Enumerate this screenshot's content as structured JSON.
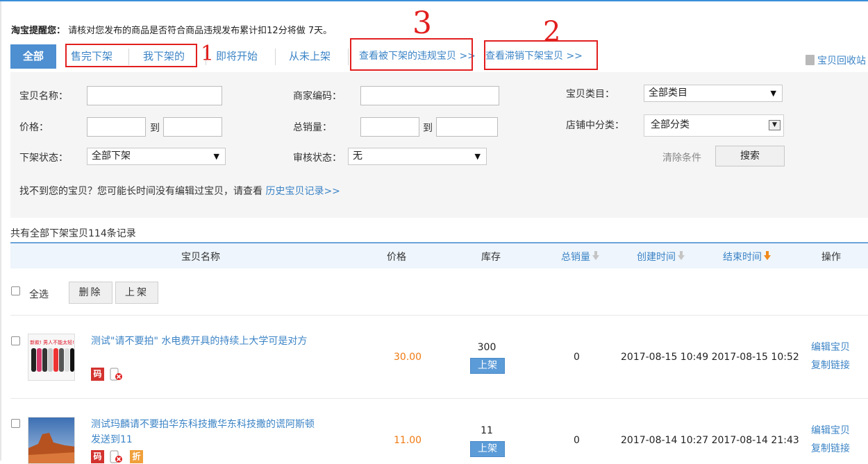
{
  "notice": {
    "prefix": "淘宝提醒您：",
    "text": "请核对您发布的商品是否符合商品违规发布累计扣12分将做 7天。"
  },
  "tabs": {
    "all": "全部",
    "sold_out": "售完下架",
    "mine": "我下架的",
    "coming": "即将开始",
    "never": "从未上架",
    "violations": "查看被下架的违规宝贝 >>",
    "slow": "查看滞销下架宝贝 >>",
    "recycle": "宝贝回收站"
  },
  "annotations": {
    "mark1": "1",
    "mark2": "2",
    "mark3": "3"
  },
  "filters": {
    "name_label": "宝贝名称：",
    "code_label": "商家编码：",
    "category_label": "宝贝类目：",
    "category_value": "全部类目",
    "price_label": "价格：",
    "to": "到",
    "sales_label": "总销量：",
    "shop_cat_label": "店铺中分类：",
    "shop_cat_value": "全部分类",
    "status_label": "下架状态：",
    "status_value": "全部下架",
    "review_label": "审核状态：",
    "review_value": "无",
    "clear": "清除条件",
    "search": "搜索",
    "hint_text": "找不到您的宝贝？您可能长时间没有编辑过宝贝，请查看 ",
    "hint_link": "历史宝贝记录>>"
  },
  "summary": "共有全部下架宝贝114条记录",
  "table": {
    "headers": {
      "name": "宝贝名称",
      "price": "价格",
      "stock": "库存",
      "sales": "总销量",
      "created": "创建时间",
      "ended": "结束时间",
      "ops": "操作"
    },
    "select_all": "全选",
    "delete": "删除",
    "list": "上架",
    "rows": [
      {
        "title": "测试\"请不要拍\" 水电费开具的持续上大学可是对方",
        "price": "30.00",
        "stock": "300",
        "shelf": "上架",
        "sales": "0",
        "dates": "2017-08-15 10:49 2017-08-15 10:52",
        "edit": "编辑宝贝",
        "copy": "复制链接",
        "badge1": "码"
      },
      {
        "title": "测试玛麟请不要拍华东科技撒华东科技撒的谎阿斯顿发送到11",
        "price": "11.00",
        "stock": "11",
        "shelf": "上架",
        "sales": "0",
        "dates": "2017-08-14 10:27 2017-08-14 21:43",
        "edit": "编辑宝贝",
        "copy": "复制链接",
        "badge1": "码",
        "badge2": "折"
      }
    ]
  },
  "thumb_text": "新款! 男人不能太轻!",
  "colors": {
    "accent": "#4d8fd1",
    "link": "#3c84c6",
    "price": "#ef7a12",
    "annotation": "#e21e1e"
  }
}
